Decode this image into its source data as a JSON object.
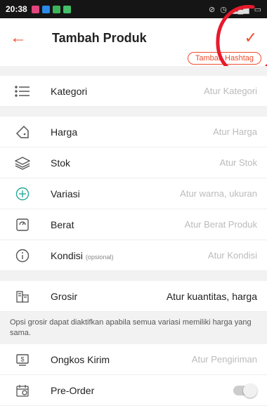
{
  "statusbar": {
    "time": "20:38"
  },
  "header": {
    "title": "Tambah Produk",
    "back_icon": "arrow-left-icon",
    "confirm_icon": "check-icon"
  },
  "hashtag": {
    "label": "Tambah Hashtag"
  },
  "rows": {
    "kategori": {
      "label": "Kategori",
      "value": "Atur Kategori"
    },
    "harga": {
      "label": "Harga",
      "value": "Atur Harga"
    },
    "stok": {
      "label": "Stok",
      "value": "Atur Stok"
    },
    "variasi": {
      "label": "Variasi",
      "value": "Atur warna, ukuran"
    },
    "berat": {
      "label": "Berat",
      "value": "Atur Berat Produk"
    },
    "kondisi": {
      "label": "Kondisi",
      "optional": "(opsional)",
      "value": "Atur Kondisi"
    },
    "grosir": {
      "label": "Grosir",
      "value": "Atur kuantitas, harga"
    },
    "ongkir": {
      "label": "Ongkos Kirim",
      "value": "Atur Pengiriman"
    },
    "preorder": {
      "label": "Pre-Order"
    }
  },
  "grosir_note": "Opsi grosir dapat diaktifkan apabila semua variasi memiliki harga yang sama.",
  "colors": {
    "accent": "#ee4d2d",
    "variasi_icon": "#26aa99"
  }
}
